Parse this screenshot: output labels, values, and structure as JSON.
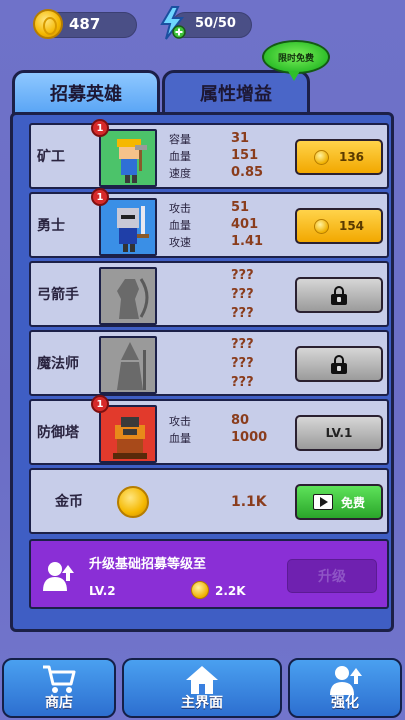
{
  "status": {
    "coins": "487",
    "energy": "50/50"
  },
  "tabs": {
    "recruit": "招募英雄",
    "attributes": "属性增益",
    "free_badge": "限时免费"
  },
  "rows": [
    {
      "name": "矿工",
      "badge": "1",
      "stats": [
        {
          "label": "容量",
          "value": "31"
        },
        {
          "label": "血量",
          "value": "151"
        },
        {
          "label": "速度",
          "value": "0.85"
        }
      ],
      "button": "136"
    },
    {
      "name": "勇士",
      "badge": "1",
      "stats": [
        {
          "label": "攻击",
          "value": "51"
        },
        {
          "label": "血量",
          "value": "401"
        },
        {
          "label": "攻速",
          "value": "1.41"
        }
      ],
      "button": "154"
    },
    {
      "name": "弓箭手",
      "unknown": [
        "???",
        "???",
        "???"
      ]
    },
    {
      "name": "魔法师",
      "unknown": [
        "???",
        "???",
        "???"
      ]
    },
    {
      "name": "防御塔",
      "badge": "1",
      "stats": [
        {
          "label": "攻击",
          "value": "80"
        },
        {
          "label": "血量",
          "value": "1000"
        }
      ],
      "button": "LV.1"
    },
    {
      "name": "金币",
      "amount": "1.1K",
      "button": "免费"
    }
  ],
  "upgrade": {
    "title": "升级基础招募等级至",
    "level": "LV.2",
    "cost": "2.2K",
    "button": "升级"
  },
  "nav": {
    "shop": "商店",
    "main": "主界面",
    "power": "强化"
  },
  "colors": {
    "background": "#6f72c9",
    "panel": "#3f5ec4",
    "row": "#c7cde9",
    "gold_button": "#f2a800",
    "upgrade_bg": "#8a2fd6",
    "nav": "#3a86e0"
  },
  "icons": {
    "coin": "coin-icon",
    "energy": "lightning-plus-icon",
    "lock": "lock-icon",
    "video": "video-play-icon",
    "cart": "shopping-cart-icon",
    "home": "home-icon",
    "upgrade_user": "user-upgrade-icon"
  }
}
